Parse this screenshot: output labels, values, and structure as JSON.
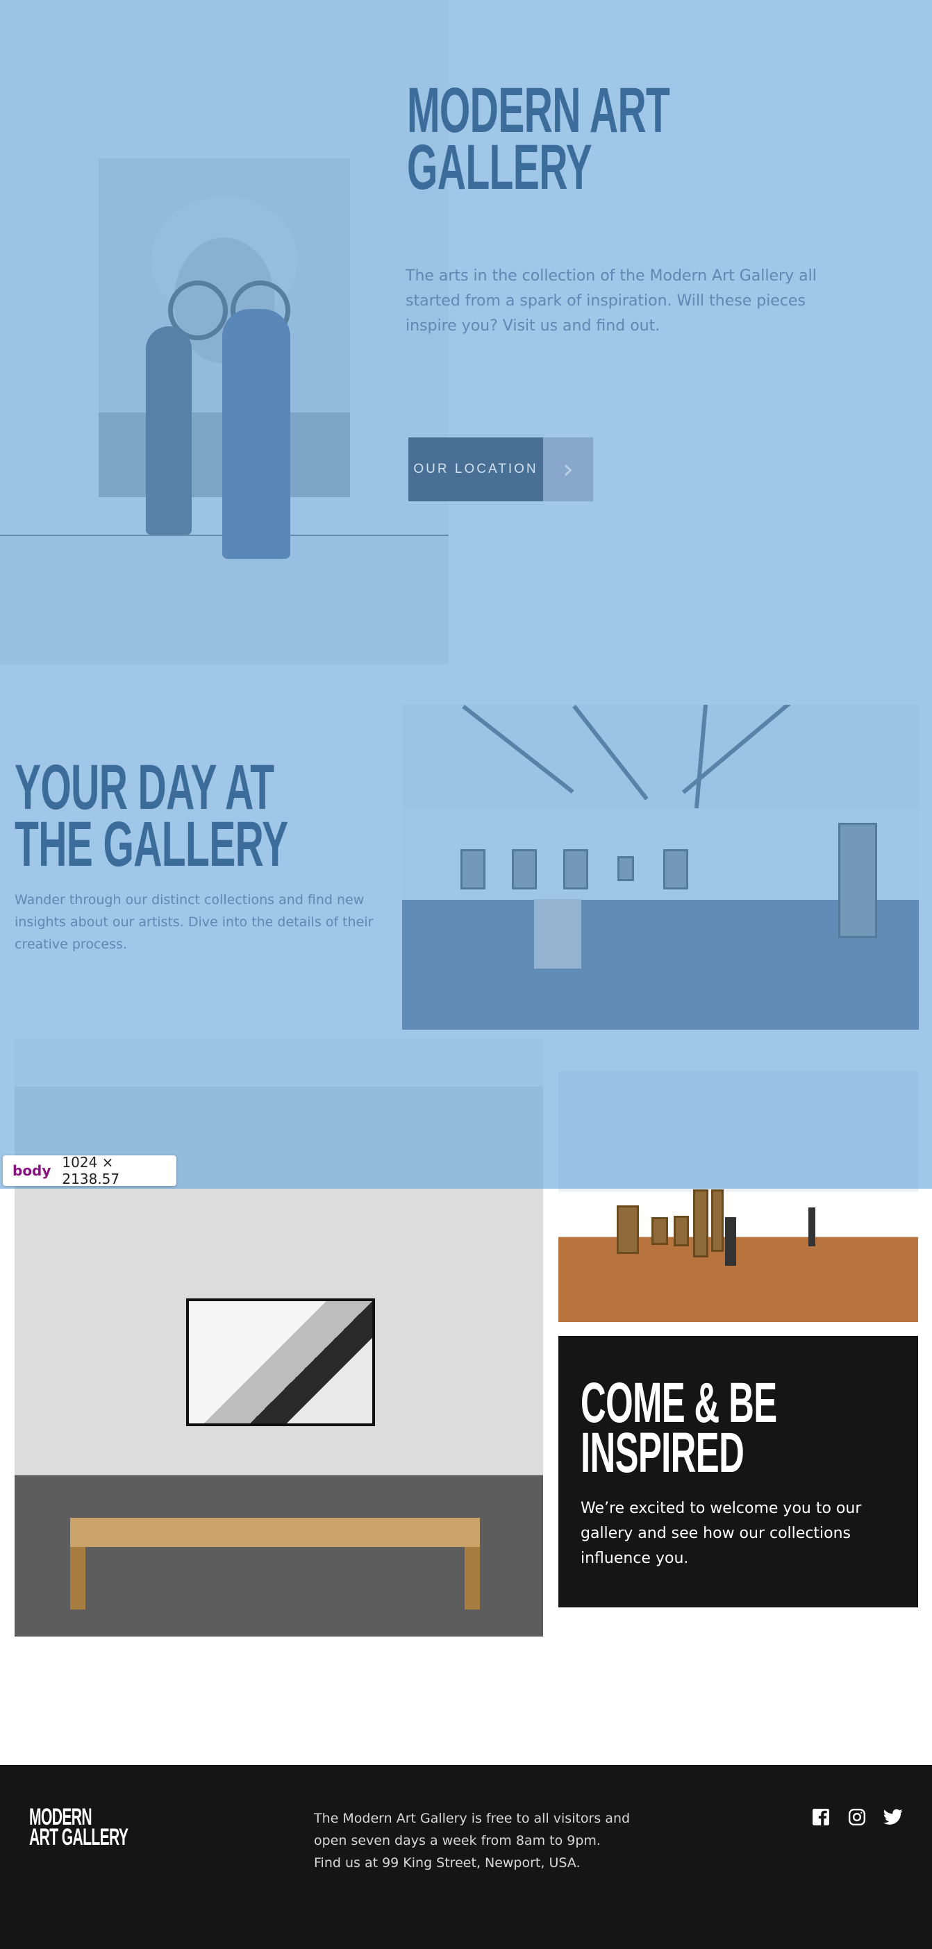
{
  "hero": {
    "title_line1": "MODERN ART",
    "title_line2": "GALLERY",
    "copy": "The arts in the collection of the Modern Art Gallery all started from a spark of inspiration. Will these pieces inspire you? Visit us and find out.",
    "cta_label": "OUR LOCATION",
    "cta_arrow": "›"
  },
  "day": {
    "title_line1": "YOUR DAY AT",
    "title_line2": "THE GALLERY",
    "copy": "Wander through our distinct collections and find new insights about our artists. Dive into the details of their creative process."
  },
  "inspire": {
    "title_line1": "COME & BE",
    "title_line2": "INSPIRED",
    "copy": "We’re excited to welcome you to our gallery and see how our collections influence you."
  },
  "devtools": {
    "tag": "body",
    "dims": "1024 × 2138.57"
  },
  "footer": {
    "logo_line1": "MODERN",
    "logo_line2": "ART GALLERY",
    "copy": "The Modern Art Gallery is free to all visitors and open seven days a week from 8am to 9pm. Find us at 99 King Street, Newport, USA.",
    "social": [
      "facebook-icon",
      "instagram-icon",
      "twitter-icon"
    ]
  },
  "colors": {
    "overlay": "#6fa8dc",
    "heading_tint": "#3c6c99",
    "dark": "#151515"
  }
}
